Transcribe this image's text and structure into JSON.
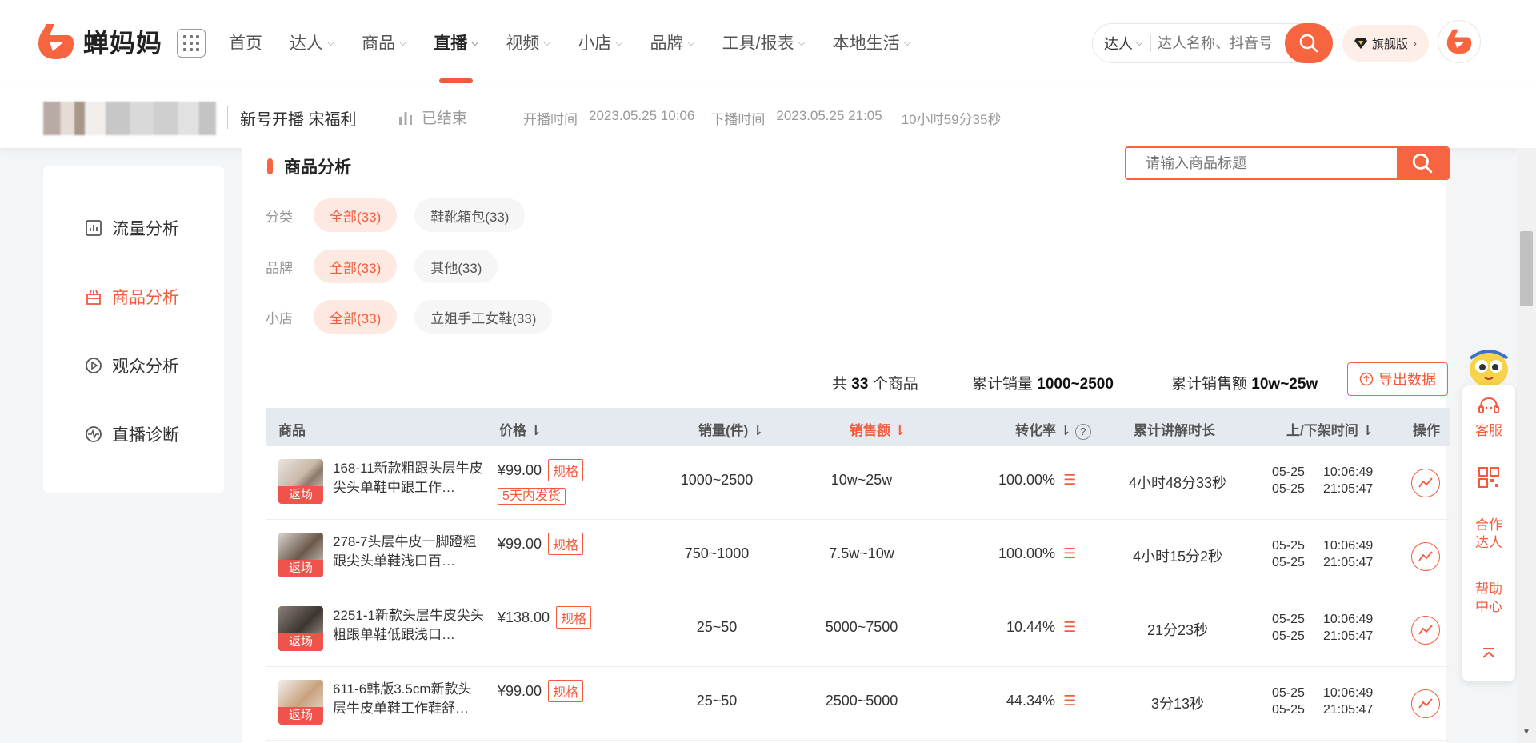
{
  "brand": {
    "name": "蝉妈妈"
  },
  "nav": {
    "items": [
      {
        "label": "首页",
        "has_dropdown": false,
        "active": false
      },
      {
        "label": "达人",
        "has_dropdown": true,
        "active": false
      },
      {
        "label": "商品",
        "has_dropdown": true,
        "active": false
      },
      {
        "label": "直播",
        "has_dropdown": true,
        "active": true
      },
      {
        "label": "视频",
        "has_dropdown": true,
        "active": false
      },
      {
        "label": "小店",
        "has_dropdown": true,
        "active": false
      },
      {
        "label": "品牌",
        "has_dropdown": true,
        "active": false
      },
      {
        "label": "工具/报表",
        "has_dropdown": true,
        "active": false
      },
      {
        "label": "本地生活",
        "has_dropdown": true,
        "active": false
      }
    ]
  },
  "top_search": {
    "type_label": "达人",
    "placeholder": "达人名称、抖音号"
  },
  "vip": {
    "label": "旗舰版"
  },
  "live": {
    "title": "新号开播 宋福利",
    "status": "已结束",
    "start_label": "开播时间",
    "start_time": "2023.05.25 10:06",
    "end_label": "下播时间",
    "end_time": "2023.05.25 21:05",
    "duration": "10小时59分35秒"
  },
  "sidebar": {
    "items": [
      {
        "label": "流量分析",
        "icon": "chart-icon",
        "active": false
      },
      {
        "label": "商品分析",
        "icon": "goods-icon",
        "active": true
      },
      {
        "label": "观众分析",
        "icon": "play-circle-icon",
        "active": false
      },
      {
        "label": "直播诊断",
        "icon": "pulse-icon",
        "active": false
      }
    ]
  },
  "section": {
    "title": "商品分析",
    "search_placeholder": "请输入商品标题"
  },
  "filters": {
    "category": {
      "label": "分类",
      "chips": [
        "全部(33)",
        "鞋靴箱包(33)"
      ]
    },
    "brand": {
      "label": "品牌",
      "chips": [
        "全部(33)",
        "其他(33)"
      ]
    },
    "shop": {
      "label": "小店",
      "chips": [
        "全部(33)",
        "立姐手工女鞋(33)"
      ]
    }
  },
  "summary": {
    "count_prefix": "共",
    "count": "33",
    "count_suffix": "个商品",
    "sales_label": "累计销量",
    "sales_value": "1000~2500",
    "revenue_label": "累计销售额",
    "revenue_value": "10w~25w",
    "export_label": "导出数据"
  },
  "table": {
    "headers": {
      "product": "商品",
      "price": "价格",
      "sales": "销量(件)",
      "revenue": "销售额",
      "conversion": "转化率",
      "explain": "累计讲解时长",
      "shelf_time": "上/下架时间",
      "action": "操作"
    },
    "rows": [
      {
        "tag": "返场",
        "name": "168-11新款粗跟头层牛皮尖头单鞋中跟工作…",
        "price": "¥99.00",
        "spec": "规格",
        "shipping": "5天内发货",
        "sales": "1000~2500",
        "revenue": "10w~25w",
        "conversion": "100.00%",
        "explain": "4小时48分33秒",
        "up_date": "05-25",
        "up_time": "10:06:49",
        "down_date": "05-25",
        "down_time": "21:05:47"
      },
      {
        "tag": "返场",
        "name": "278-7头层牛皮一脚蹬粗跟尖头单鞋浅口百…",
        "price": "¥99.00",
        "spec": "规格",
        "shipping": "",
        "sales": "750~1000",
        "revenue": "7.5w~10w",
        "conversion": "100.00%",
        "explain": "4小时15分2秒",
        "up_date": "05-25",
        "up_time": "10:06:49",
        "down_date": "05-25",
        "down_time": "21:05:47"
      },
      {
        "tag": "返场",
        "name": "2251-1新款头层牛皮尖头粗跟单鞋低跟浅口…",
        "price": "¥138.00",
        "spec": "规格",
        "shipping": "",
        "sales": "25~50",
        "revenue": "5000~7500",
        "conversion": "10.44%",
        "explain": "21分23秒",
        "up_date": "05-25",
        "up_time": "10:06:49",
        "down_date": "05-25",
        "down_time": "21:05:47"
      },
      {
        "tag": "返场",
        "name": "611-6韩版3.5cm新款头层牛皮单鞋工作鞋舒…",
        "price": "¥99.00",
        "spec": "规格",
        "shipping": "",
        "sales": "25~50",
        "revenue": "2500~5000",
        "conversion": "44.34%",
        "explain": "3分13秒",
        "up_date": "05-25",
        "up_time": "10:06:49",
        "down_date": "05-25",
        "down_time": "21:05:47"
      }
    ]
  },
  "float_bar": {
    "service": "客服",
    "coop": "合作达人",
    "help": "帮助中心"
  },
  "colors": {
    "accent": "#f6653f",
    "accent_text": "#f45a3b",
    "header_bg": "#e5eaf0"
  }
}
